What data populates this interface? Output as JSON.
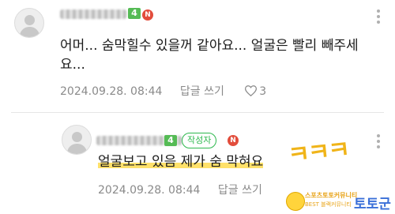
{
  "comments": [
    {
      "badge_level": "4",
      "badge_n": "N",
      "text": "어머... 숨막힐수 있을꺼 같아요... 얼굴은 빨리 빼주세요...",
      "date": "2024.09.28. 08:44",
      "reply_label": "답글 쓰기",
      "like_count": "3"
    },
    {
      "badge_level": "4",
      "author_badge": "작성자",
      "badge_n": "N",
      "text": "얼굴보고 있음 제가 숨 막혀요",
      "date": "2024.09.28. 08:44",
      "reply_label": "답글 쓰기"
    }
  ],
  "overlay": {
    "handwriting": "ㅋㅋㅋ",
    "watermark_line1": "스포츠토토커뮤니티",
    "watermark_line2": "BEST 블랙커뮤니티",
    "watermark_brand": "토토군"
  },
  "colors": {
    "level_badge": "#55bb55",
    "author_badge": "#2db84d",
    "n_badge": "#e24d3c",
    "highlight": "#ffe16a",
    "handwriting": "#f0b419",
    "meta_text": "#8a8a8a"
  },
  "icons": [
    "avatar-placeholder",
    "more-vertical-icon",
    "heart-icon"
  ]
}
